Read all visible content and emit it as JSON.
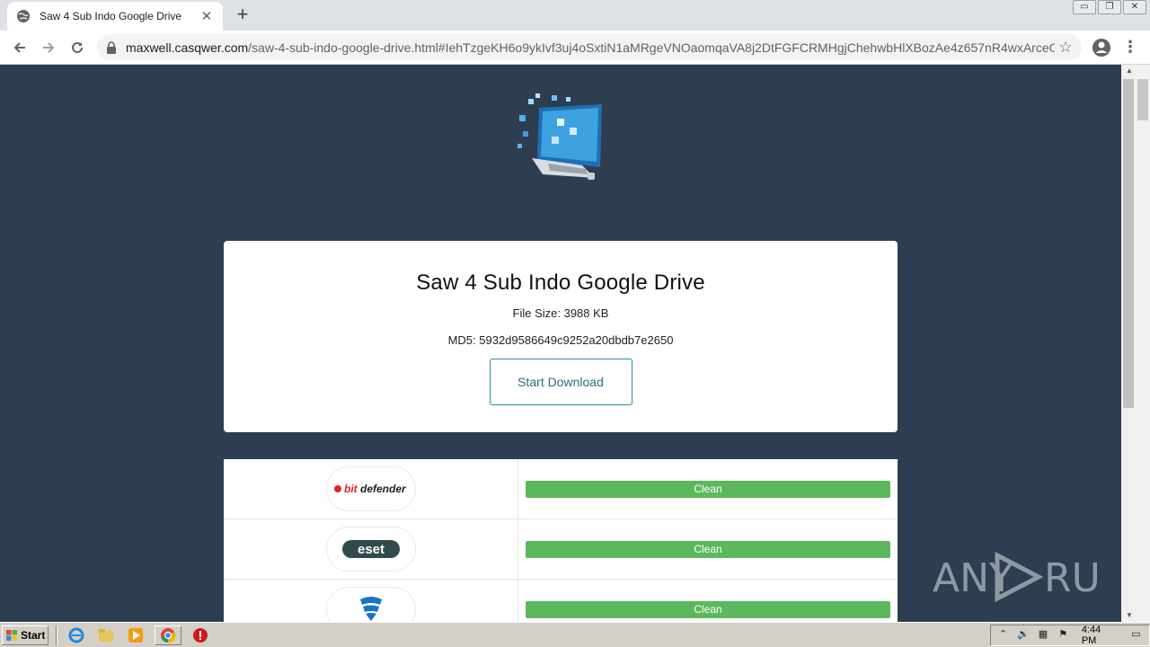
{
  "browser": {
    "tab_title": "Saw 4 Sub Indo Google Drive",
    "tab_close": "✕",
    "new_tab": "+",
    "url_host": "maxwell.casqwer.com",
    "url_path": "/saw-4-sub-indo-google-drive.html#IehTzgeKH6o9ykIvf3uj4oSxtiN1aMRgeVNOaomqaVA8j2DtFGFCRMHgjChehwbHlXBozAe4z657nR4wxArceO...",
    "window_controls": [
      "▭",
      "❐",
      "✕"
    ],
    "menu_glyph": "⋮",
    "star_glyph": "☆"
  },
  "page": {
    "title": "Saw 4 Sub Indo Google Drive",
    "file_size_label": "File Size: 3988 KB",
    "md5_label": "MD5: 5932d9586649c9252a20dbdb7e2650",
    "download_button": "Start Download",
    "scan_results": [
      {
        "vendor": "bitdefender",
        "status": "Clean"
      },
      {
        "vendor": "ESET",
        "status": "Clean"
      },
      {
        "vendor": "F-Secure",
        "status": "Clean"
      }
    ],
    "watermark": "ANY RUN"
  },
  "taskbar": {
    "start_label": "Start",
    "clock": "4:44 PM"
  },
  "colors": {
    "page_bg": "#2d3e50",
    "clean_bar": "#5cb85c",
    "download_border": "#2b8c9a"
  }
}
